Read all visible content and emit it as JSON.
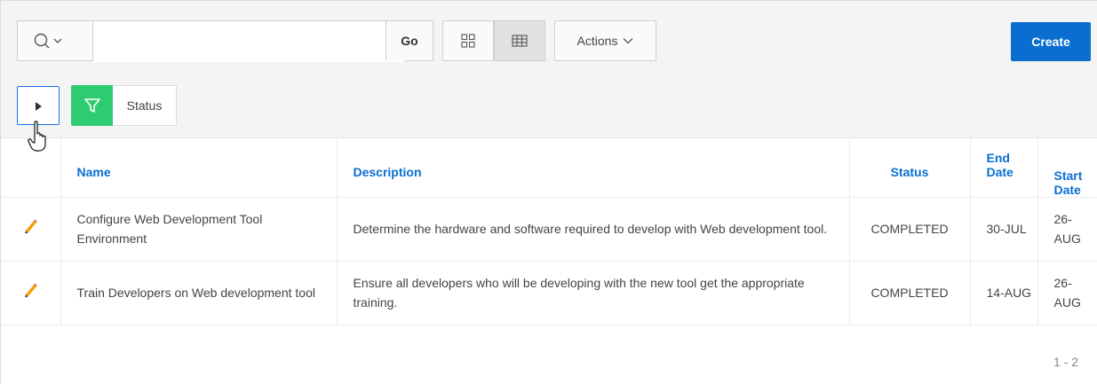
{
  "toolbar": {
    "search_placeholder": "",
    "go_label": "Go",
    "actions_label": "Actions",
    "create_label": "Create"
  },
  "filters": {
    "filter_label": "Status"
  },
  "table": {
    "headers": {
      "name": "Name",
      "description": "Description",
      "status": "Status",
      "end_date": "End Date",
      "start_date": "Start Date"
    },
    "rows": [
      {
        "name": "Configure Web Development Tool Environment",
        "description": "Determine the hardware and software required to develop with Web development tool.",
        "status": "COMPLETED",
        "end_date": "30-JUL",
        "start_date": "26-AUG"
      },
      {
        "name": "Train Developers on Web development tool",
        "description": "Ensure all developers who will be developing with the new tool get the appropriate training.",
        "status": "COMPLETED",
        "end_date": "14-AUG",
        "start_date": "26-AUG"
      }
    ]
  },
  "pagination": "1 - 2",
  "colors": {
    "primary": "#0a6ed1",
    "filter_green": "#2ecc71",
    "edit_pencil": "#f0a30a"
  },
  "icons": {
    "search": "search-icon",
    "icon_view": "grid-icon",
    "report_view": "table-icon",
    "filter": "filter-icon",
    "edit": "pencil-icon",
    "cursor": "hand-pointer-icon"
  }
}
